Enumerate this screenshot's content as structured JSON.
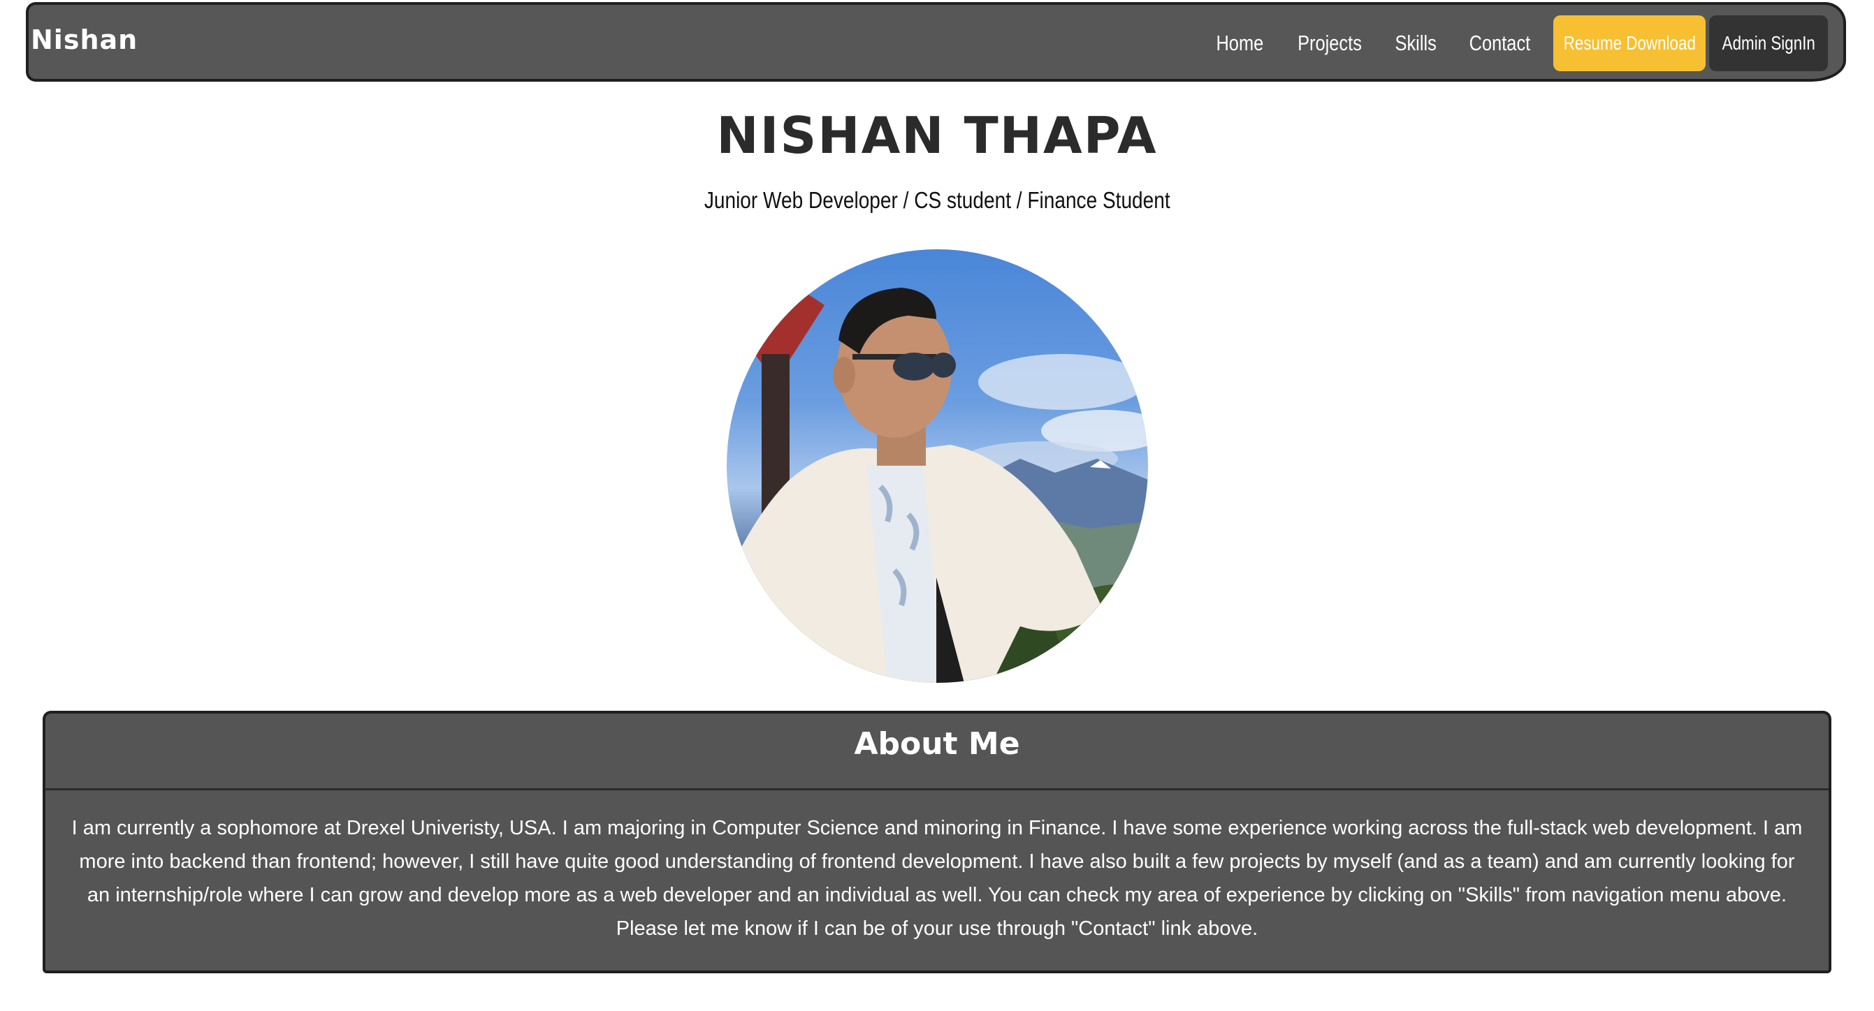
{
  "navbar": {
    "brand": "Nishan",
    "links": [
      "Home",
      "Projects",
      "Skills",
      "Contact"
    ],
    "resume_button": "Resume Download",
    "admin_button": "Admin SignIn",
    "resume_color": "#f7c032",
    "admin_color": "#333333"
  },
  "hero": {
    "name": "NISHAN THAPA",
    "subtitle": "Junior Web Developer / CS student / Finance Student"
  },
  "about": {
    "title": "About Me",
    "text": "I am currently a sophomore at Drexel Univeristy, USA. I am majoring in Computer Science and minoring in Finance. I have some experience working across the full-stack web development. I am more into backend than frontend; however, I still have quite good understanding of frontend development. I have also built a few projects by myself (and as a team) and am currently looking for an internship/role where I can grow and develop more as a web developer and an individual as well. You can check my area of experience by clicking on \"Skills\" from navigation menu above. Please let me know if I can be of your use through \"Contact\" link above."
  }
}
